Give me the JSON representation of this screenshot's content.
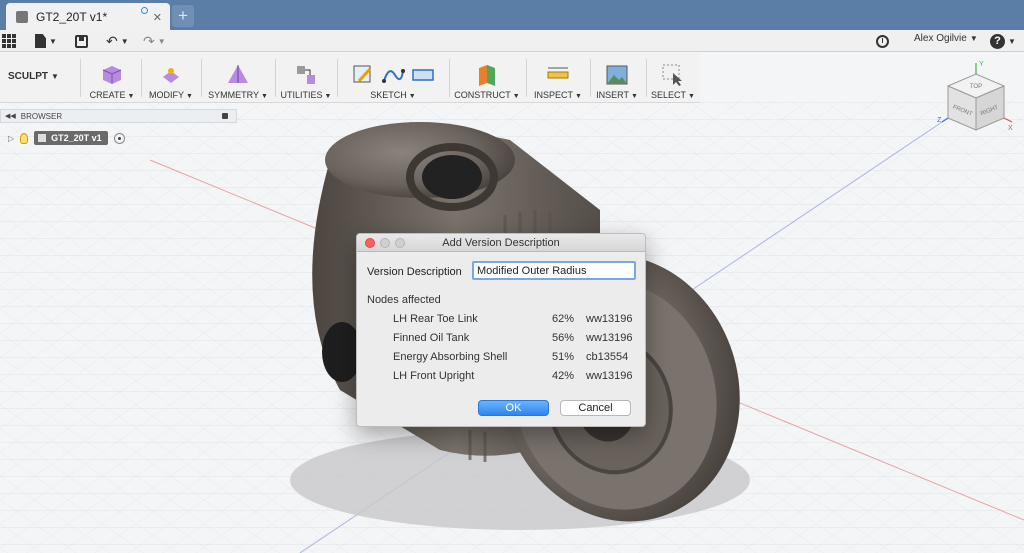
{
  "document_tab": {
    "title": "GT2_20T v1*",
    "close": "✕"
  },
  "add_tab": "+",
  "user": {
    "name": "Alex Ogilvie"
  },
  "workspace": "SCULPT",
  "ribbon_groups": [
    "CREATE",
    "MODIFY",
    "SYMMETRY",
    "UTILITIES",
    "SKETCH",
    "CONSTRUCT",
    "INSPECT",
    "INSERT",
    "SELECT"
  ],
  "browser": {
    "title": "BROWSER",
    "node": "GT2_20T v1"
  },
  "viewcube": {
    "top": "TOP",
    "left": "FRONT",
    "right": "RIGHT",
    "axis_x": "X",
    "axis_y": "Y",
    "axis_z": "Z"
  },
  "dialog": {
    "title": "Add Version Description",
    "field_label": "Version Description",
    "field_value": "Modified Outer Radius",
    "nodes_title": "Nodes affected",
    "nodes": [
      {
        "name": "LH Rear Toe Link",
        "pct": "62%",
        "code": "ww13196"
      },
      {
        "name": "Finned Oil Tank",
        "pct": "56%",
        "code": "ww13196"
      },
      {
        "name": "Energy Absorbing Shell",
        "pct": "51%",
        "code": "cb13554"
      },
      {
        "name": "LH Front Upright",
        "pct": "42%",
        "code": "ww13196"
      }
    ],
    "ok": "OK",
    "cancel": "Cancel"
  },
  "colors": {
    "tabbar": "#5b7ea6",
    "primary_button": "#2f86f2",
    "part_metal": "#6d6560"
  }
}
